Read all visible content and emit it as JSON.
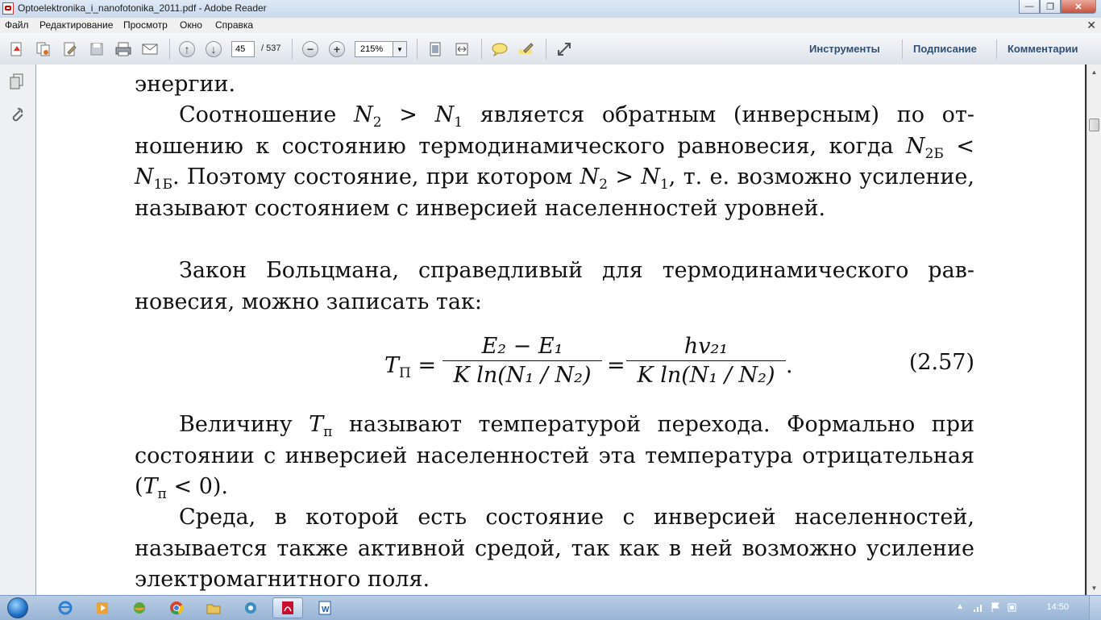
{
  "window": {
    "title": "Optoelektronika_i_nanofotonika_2011.pdf - Adobe Reader"
  },
  "menu": [
    "Файл",
    "Редактирование",
    "Просмотр",
    "Окно",
    "Справка"
  ],
  "toolbar": {
    "page_current": "45",
    "page_total": "/ 537",
    "zoom": "215%",
    "tabs": [
      "Инструменты",
      "Подписание",
      "Комментарии"
    ]
  },
  "document": {
    "line_top": "энергии.",
    "p1_a": "Соотношение ",
    "p1_b": " является обратным (инверсным) по от­ношению к состоянию термодинамического равновесия, когда ",
    "p1_c": ". Поэтому состояние, при котором ",
    "p1_d": ", т. е. возмож­но усиление, называют состоянием с инверсией населенностей уровней.",
    "N2": "N",
    "sub2": "2",
    "sub1": "1",
    "sub2B": "2Б",
    "sub1B": "1Б",
    "gt": " > ",
    "lt": " < ",
    "p2": "Закон Больцмана, справедливый для термодинамического рав­новесия, можно записать так:",
    "eq": {
      "T": "T",
      "Tsub": "П",
      "eq_sign": "=",
      "num1": "E₂ − E₁",
      "den1": "K ln(N₁ / N₂)",
      "num2": "hv₂₁",
      "den2": "K ln(N₁ / N₂)",
      "dot": ".",
      "number": "(2.57)"
    },
    "p3_a": "Величину ",
    "p3_Tsub": "п",
    "p3_b": " называют температурой перехода. Формально при состоянии с инверсией населенностей эта температура отрицатель­ная (",
    "p3_c": " < 0).",
    "p4": "Среда, в которой есть состояние с инверсией населенностей, называется также активной средой, так как в ней возможно уси­ление электромагнитного поля."
  },
  "taskbar": {
    "clock": "14:50"
  }
}
